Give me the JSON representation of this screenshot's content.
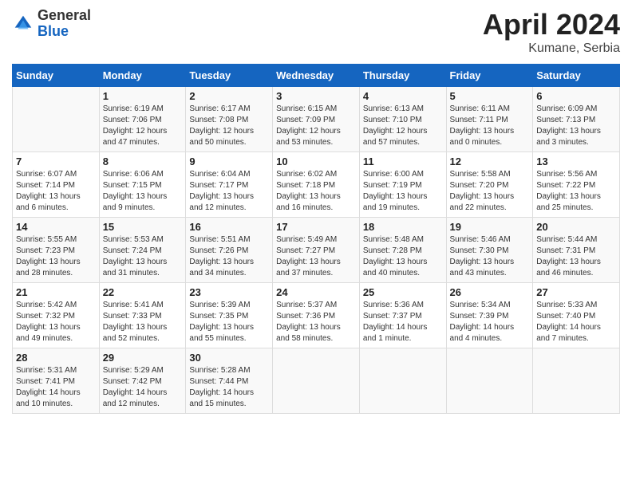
{
  "header": {
    "logo_general": "General",
    "logo_blue": "Blue",
    "title": "April 2024",
    "location": "Kumane, Serbia"
  },
  "days_of_week": [
    "Sunday",
    "Monday",
    "Tuesday",
    "Wednesday",
    "Thursday",
    "Friday",
    "Saturday"
  ],
  "weeks": [
    [
      {
        "day": "",
        "sunrise": "",
        "sunset": "",
        "daylight": ""
      },
      {
        "day": "1",
        "sunrise": "Sunrise: 6:19 AM",
        "sunset": "Sunset: 7:06 PM",
        "daylight": "Daylight: 12 hours and 47 minutes."
      },
      {
        "day": "2",
        "sunrise": "Sunrise: 6:17 AM",
        "sunset": "Sunset: 7:08 PM",
        "daylight": "Daylight: 12 hours and 50 minutes."
      },
      {
        "day": "3",
        "sunrise": "Sunrise: 6:15 AM",
        "sunset": "Sunset: 7:09 PM",
        "daylight": "Daylight: 12 hours and 53 minutes."
      },
      {
        "day": "4",
        "sunrise": "Sunrise: 6:13 AM",
        "sunset": "Sunset: 7:10 PM",
        "daylight": "Daylight: 12 hours and 57 minutes."
      },
      {
        "day": "5",
        "sunrise": "Sunrise: 6:11 AM",
        "sunset": "Sunset: 7:11 PM",
        "daylight": "Daylight: 13 hours and 0 minutes."
      },
      {
        "day": "6",
        "sunrise": "Sunrise: 6:09 AM",
        "sunset": "Sunset: 7:13 PM",
        "daylight": "Daylight: 13 hours and 3 minutes."
      }
    ],
    [
      {
        "day": "7",
        "sunrise": "Sunrise: 6:07 AM",
        "sunset": "Sunset: 7:14 PM",
        "daylight": "Daylight: 13 hours and 6 minutes."
      },
      {
        "day": "8",
        "sunrise": "Sunrise: 6:06 AM",
        "sunset": "Sunset: 7:15 PM",
        "daylight": "Daylight: 13 hours and 9 minutes."
      },
      {
        "day": "9",
        "sunrise": "Sunrise: 6:04 AM",
        "sunset": "Sunset: 7:17 PM",
        "daylight": "Daylight: 13 hours and 12 minutes."
      },
      {
        "day": "10",
        "sunrise": "Sunrise: 6:02 AM",
        "sunset": "Sunset: 7:18 PM",
        "daylight": "Daylight: 13 hours and 16 minutes."
      },
      {
        "day": "11",
        "sunrise": "Sunrise: 6:00 AM",
        "sunset": "Sunset: 7:19 PM",
        "daylight": "Daylight: 13 hours and 19 minutes."
      },
      {
        "day": "12",
        "sunrise": "Sunrise: 5:58 AM",
        "sunset": "Sunset: 7:20 PM",
        "daylight": "Daylight: 13 hours and 22 minutes."
      },
      {
        "day": "13",
        "sunrise": "Sunrise: 5:56 AM",
        "sunset": "Sunset: 7:22 PM",
        "daylight": "Daylight: 13 hours and 25 minutes."
      }
    ],
    [
      {
        "day": "14",
        "sunrise": "Sunrise: 5:55 AM",
        "sunset": "Sunset: 7:23 PM",
        "daylight": "Daylight: 13 hours and 28 minutes."
      },
      {
        "day": "15",
        "sunrise": "Sunrise: 5:53 AM",
        "sunset": "Sunset: 7:24 PM",
        "daylight": "Daylight: 13 hours and 31 minutes."
      },
      {
        "day": "16",
        "sunrise": "Sunrise: 5:51 AM",
        "sunset": "Sunset: 7:26 PM",
        "daylight": "Daylight: 13 hours and 34 minutes."
      },
      {
        "day": "17",
        "sunrise": "Sunrise: 5:49 AM",
        "sunset": "Sunset: 7:27 PM",
        "daylight": "Daylight: 13 hours and 37 minutes."
      },
      {
        "day": "18",
        "sunrise": "Sunrise: 5:48 AM",
        "sunset": "Sunset: 7:28 PM",
        "daylight": "Daylight: 13 hours and 40 minutes."
      },
      {
        "day": "19",
        "sunrise": "Sunrise: 5:46 AM",
        "sunset": "Sunset: 7:30 PM",
        "daylight": "Daylight: 13 hours and 43 minutes."
      },
      {
        "day": "20",
        "sunrise": "Sunrise: 5:44 AM",
        "sunset": "Sunset: 7:31 PM",
        "daylight": "Daylight: 13 hours and 46 minutes."
      }
    ],
    [
      {
        "day": "21",
        "sunrise": "Sunrise: 5:42 AM",
        "sunset": "Sunset: 7:32 PM",
        "daylight": "Daylight: 13 hours and 49 minutes."
      },
      {
        "day": "22",
        "sunrise": "Sunrise: 5:41 AM",
        "sunset": "Sunset: 7:33 PM",
        "daylight": "Daylight: 13 hours and 52 minutes."
      },
      {
        "day": "23",
        "sunrise": "Sunrise: 5:39 AM",
        "sunset": "Sunset: 7:35 PM",
        "daylight": "Daylight: 13 hours and 55 minutes."
      },
      {
        "day": "24",
        "sunrise": "Sunrise: 5:37 AM",
        "sunset": "Sunset: 7:36 PM",
        "daylight": "Daylight: 13 hours and 58 minutes."
      },
      {
        "day": "25",
        "sunrise": "Sunrise: 5:36 AM",
        "sunset": "Sunset: 7:37 PM",
        "daylight": "Daylight: 14 hours and 1 minute."
      },
      {
        "day": "26",
        "sunrise": "Sunrise: 5:34 AM",
        "sunset": "Sunset: 7:39 PM",
        "daylight": "Daylight: 14 hours and 4 minutes."
      },
      {
        "day": "27",
        "sunrise": "Sunrise: 5:33 AM",
        "sunset": "Sunset: 7:40 PM",
        "daylight": "Daylight: 14 hours and 7 minutes."
      }
    ],
    [
      {
        "day": "28",
        "sunrise": "Sunrise: 5:31 AM",
        "sunset": "Sunset: 7:41 PM",
        "daylight": "Daylight: 14 hours and 10 minutes."
      },
      {
        "day": "29",
        "sunrise": "Sunrise: 5:29 AM",
        "sunset": "Sunset: 7:42 PM",
        "daylight": "Daylight: 14 hours and 12 minutes."
      },
      {
        "day": "30",
        "sunrise": "Sunrise: 5:28 AM",
        "sunset": "Sunset: 7:44 PM",
        "daylight": "Daylight: 14 hours and 15 minutes."
      },
      {
        "day": "",
        "sunrise": "",
        "sunset": "",
        "daylight": ""
      },
      {
        "day": "",
        "sunrise": "",
        "sunset": "",
        "daylight": ""
      },
      {
        "day": "",
        "sunrise": "",
        "sunset": "",
        "daylight": ""
      },
      {
        "day": "",
        "sunrise": "",
        "sunset": "",
        "daylight": ""
      }
    ]
  ]
}
